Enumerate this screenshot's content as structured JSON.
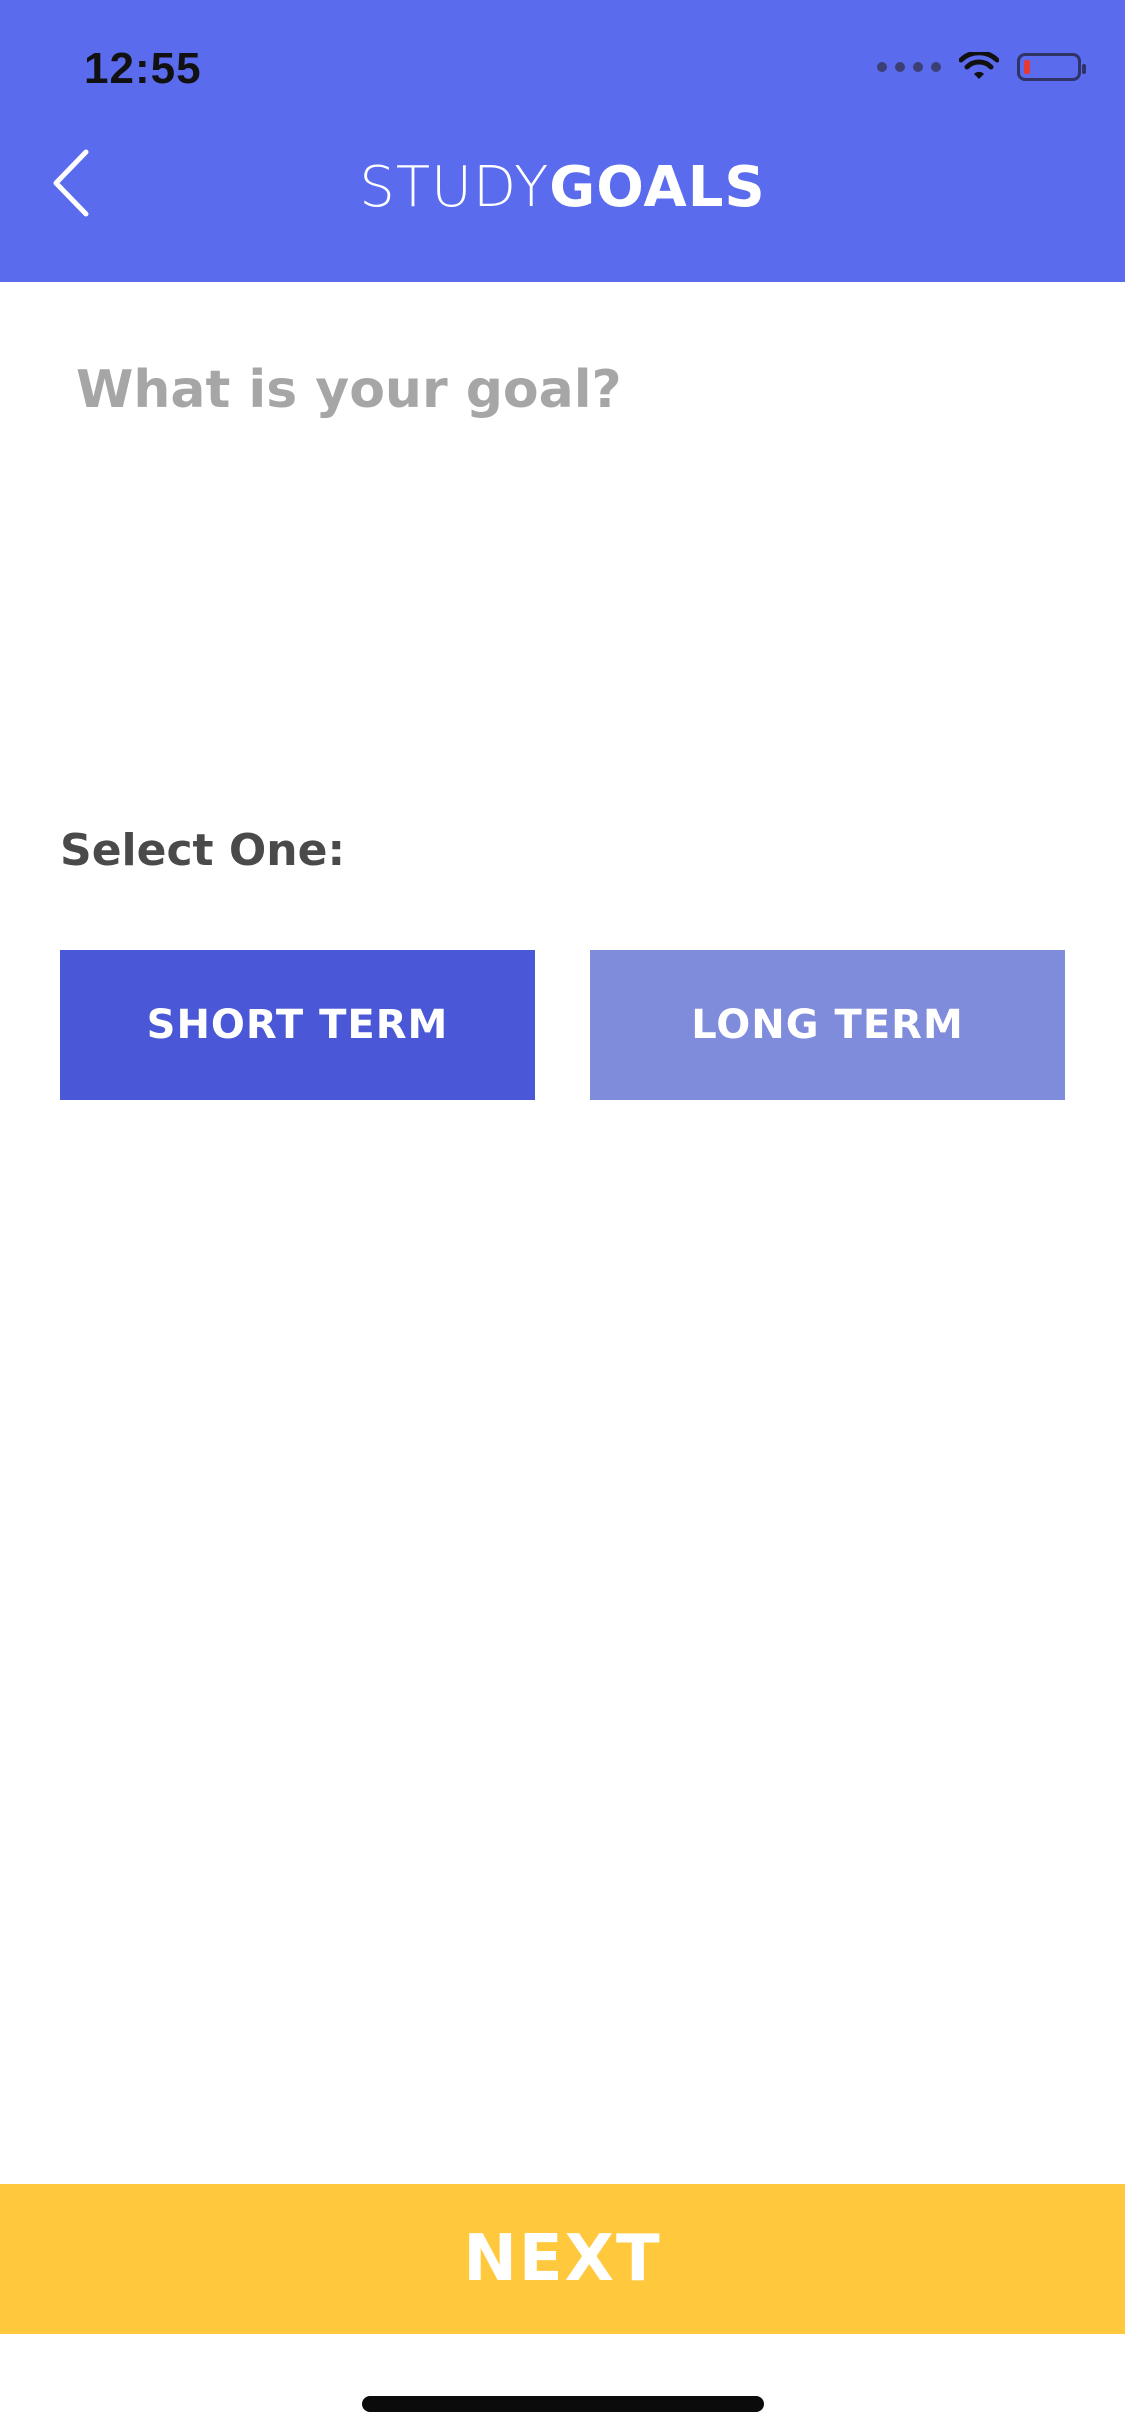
{
  "status": {
    "time": "12:55",
    "battery_level_percent": 10,
    "battery_color": "#E53935"
  },
  "nav": {
    "back_icon": "chevron-left-icon",
    "title_light": "STUDY",
    "title_bold": "GOALS"
  },
  "goal": {
    "placeholder": "What is your goal?",
    "value": ""
  },
  "selection": {
    "label": "Select One:",
    "options": [
      {
        "label": "SHORT TERM",
        "selected": true
      },
      {
        "label": "LONG TERM",
        "selected": false
      }
    ]
  },
  "footer": {
    "next_label": "NEXT"
  },
  "colors": {
    "header": "#5A6BEE",
    "selected_option": "#4A57D6",
    "unselected_option": "#7F8BDB",
    "next_bar": "#FFC83D",
    "placeholder": "#A6A6A6"
  }
}
